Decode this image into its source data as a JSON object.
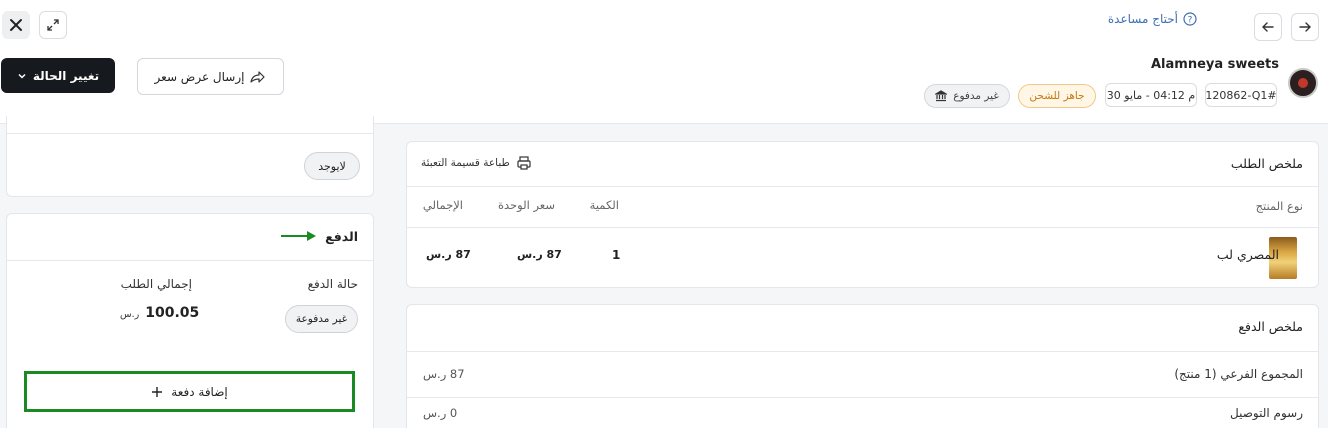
{
  "header": {
    "help_label": "أحتاج مساعدة",
    "store_name": "Alamneya sweets",
    "order_id": "120862-Q1#",
    "order_date": "م 04:12 - مايو 30",
    "shipping_status": "جاهز للشحن",
    "payment_status": "غير مدفوع",
    "change_status_label": "تغيير الحالة",
    "send_quote_label": "إرسال عرض سعر"
  },
  "left": {
    "none_badge": "لايوجد",
    "payment_title": "الدفع",
    "payment_state_label": "حالة الدفع",
    "payment_state_value": "غير مدفوعة",
    "order_total_label": "إجمالي الطلب",
    "order_total_value": "100.05",
    "currency": "ر.س",
    "add_payment_label": "إضافة دفعة",
    "highlight_color": "#1a8a22"
  },
  "order_summary": {
    "title": "ملخص الطلب",
    "print_label": "طباعة قسيمة التعبئة",
    "columns": {
      "product": "نوع المنتج",
      "qty": "الكمية",
      "unit_price": "سعر الوحدة",
      "total": "الإجمالي"
    },
    "rows": [
      {
        "name": "المصري لب",
        "qty": "1",
        "unit_price": "87 ر.س",
        "total": "87 ر.س"
      }
    ]
  },
  "payment_summary": {
    "title": "ملخص الدفع",
    "lines": [
      {
        "label": "المجموع الفرعي (1 منتج)",
        "value": "87 ر.س"
      },
      {
        "label": "رسوم التوصيل",
        "value": "0 ر.س"
      }
    ]
  }
}
